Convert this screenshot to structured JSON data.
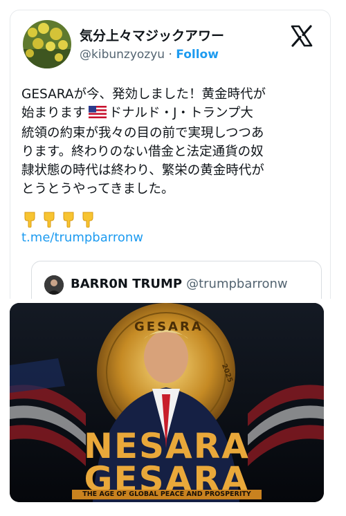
{
  "tweet": {
    "display_name": "気分上々マジックアワー",
    "handle": "@kibunzyozyu",
    "separator": " · ",
    "follow_label": "Follow",
    "text_part1": "GESARAが今、発効しました！黄金時代が\n始まります",
    "text_part2": "ドナルド・J・トランプ大\n統領の約束が我々の目の前で実現しつつあ\nります。終わりのない借金と法定通貨の奴\n隷状態の時代は終わり、繁栄の黄金時代が\nとうとうやってきました。",
    "link": "t.me/trumpbarronw"
  },
  "quote": {
    "name": "BARR0N TRUMP",
    "handle": "@trumpbarronw"
  },
  "promo": {
    "coin_text": "GESARA",
    "coin_year": "2025",
    "title_line1": "NESARA",
    "title_line2": "GESARA",
    "subtitle": "THE AGE OF GLOBAL PEACE AND PROSPERITY"
  },
  "icons": {
    "logo": "x-logo-icon",
    "flag": "us-flag-icon",
    "hands": [
      "pointing-down-icon",
      "pointing-down-icon",
      "pointing-down-icon",
      "pointing-down-icon"
    ]
  },
  "colors": {
    "link": "#1d9bf0",
    "text": "#0f1419",
    "muted": "#536471",
    "gold": "#e9a83a"
  }
}
